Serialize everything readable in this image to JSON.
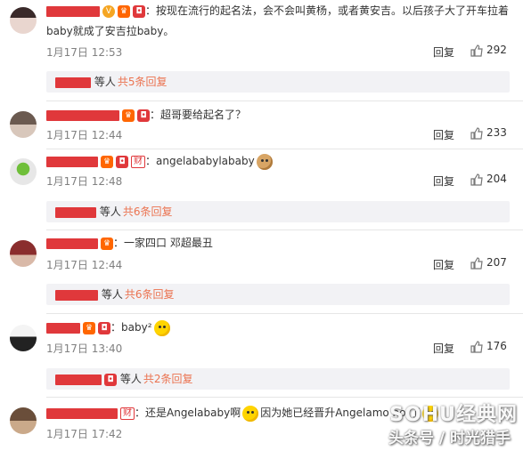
{
  "reply_label": "回复",
  "sub_suffix": "等人",
  "comments": [
    {
      "text_line1": "：按现在流行的起名法，会不会叫黄杨，或者黄安吉。以后孩子大了开车拉着",
      "text_line2": "baby就成了安吉拉baby。",
      "time": "1月17日 12:53",
      "likes": "292",
      "sub_count": "共5条回复"
    },
    {
      "text": "：超哥要给起名了？",
      "time": "1月17日 12:44",
      "likes": "233"
    },
    {
      "text": "：angelababylababy",
      "time": "1月17日 12:48",
      "likes": "204",
      "sub_count": "共6条回复"
    },
    {
      "text": "：一家四口 邓超最丑",
      "time": "1月17日 12:44",
      "likes": "207",
      "sub_count": "共6条回复"
    },
    {
      "text": "：baby²",
      "time": "1月17日 13:40",
      "likes": "176",
      "sub_count": "共2条回复"
    },
    {
      "text_a": "：还是Angelababy啊",
      "text_b": "因为她已经晋升Angelamo hor了",
      "time": "1月17日 17:42"
    }
  ],
  "badges": {
    "cai": "财"
  },
  "watermark": "SOHU经典网",
  "watermark_sub": "头条号 / 时光猎手",
  "colors": {
    "accent": "#eb7350",
    "redaction": "#e0383b",
    "time": "#808080",
    "subbox_bg": "#f2f2f5"
  },
  "icons": [
    "like-icon",
    "vip-badge-icon",
    "verified-icon",
    "smiley-emoji-icon",
    "dog-emoji-icon"
  ]
}
